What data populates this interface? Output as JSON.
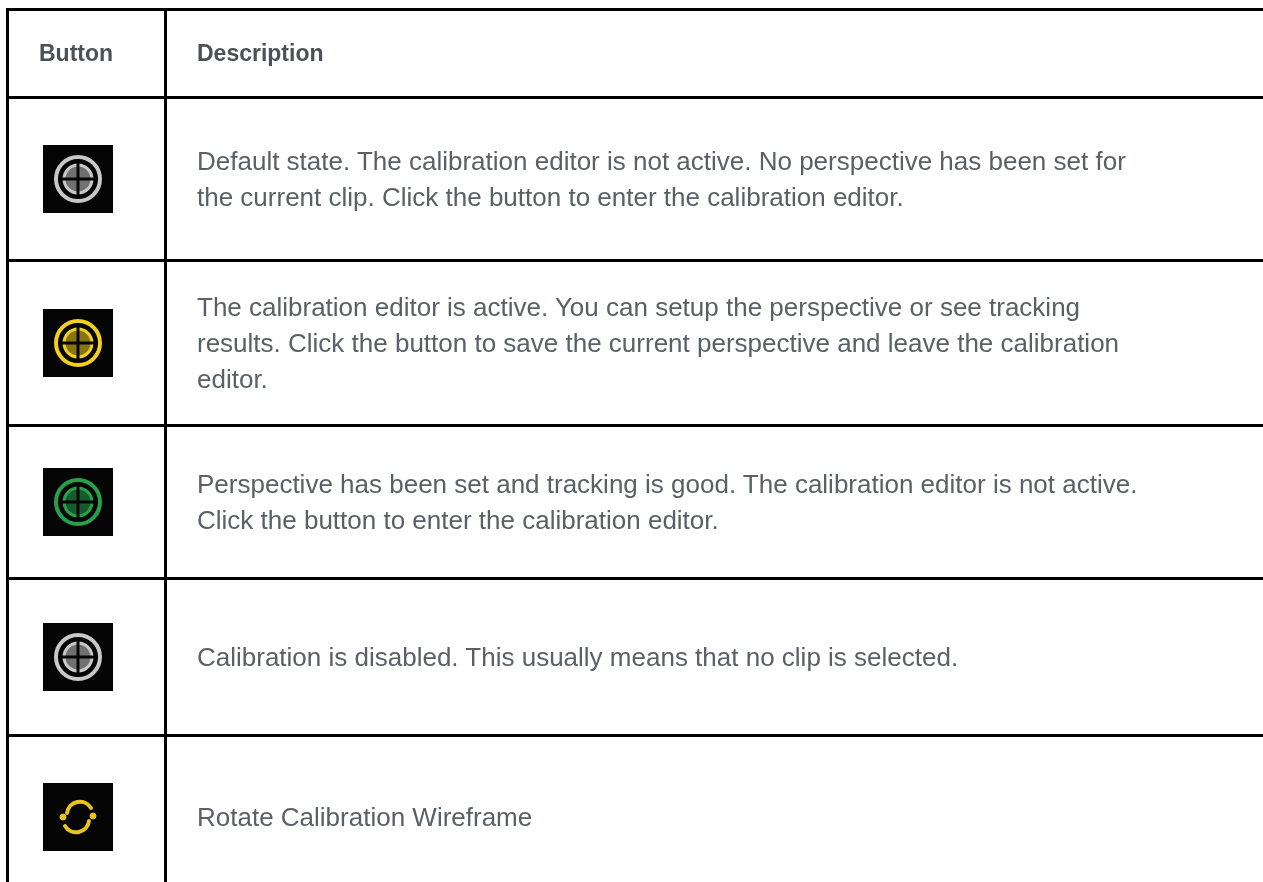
{
  "table": {
    "columns": [
      "Button",
      "Description"
    ],
    "rows": [
      {
        "icon": {
          "kind": "crosshair",
          "color": "#c8c8c8"
        },
        "description": "Default state. The calibration editor is not active. No perspective has been set for the current clip. Click the button to enter the calibration editor."
      },
      {
        "icon": {
          "kind": "crosshair",
          "color": "#f2cf1e"
        },
        "description": "The calibration editor is active. You can setup the perspective or see tracking results. Click the button to save the current perspective and leave the calibration editor."
      },
      {
        "icon": {
          "kind": "crosshair",
          "color": "#27a04a"
        },
        "description": "Perspective has been set and tracking is good. The calibration editor is not active. Click the button to enter the calibration editor."
      },
      {
        "icon": {
          "kind": "crosshair",
          "color": "#c8c8c8"
        },
        "description": "Calibration is disabled. This usually means that no clip is selected."
      },
      {
        "icon": {
          "kind": "rotate",
          "color": "#e8c320"
        },
        "description": "Rotate Calibration Wireframe"
      }
    ]
  }
}
